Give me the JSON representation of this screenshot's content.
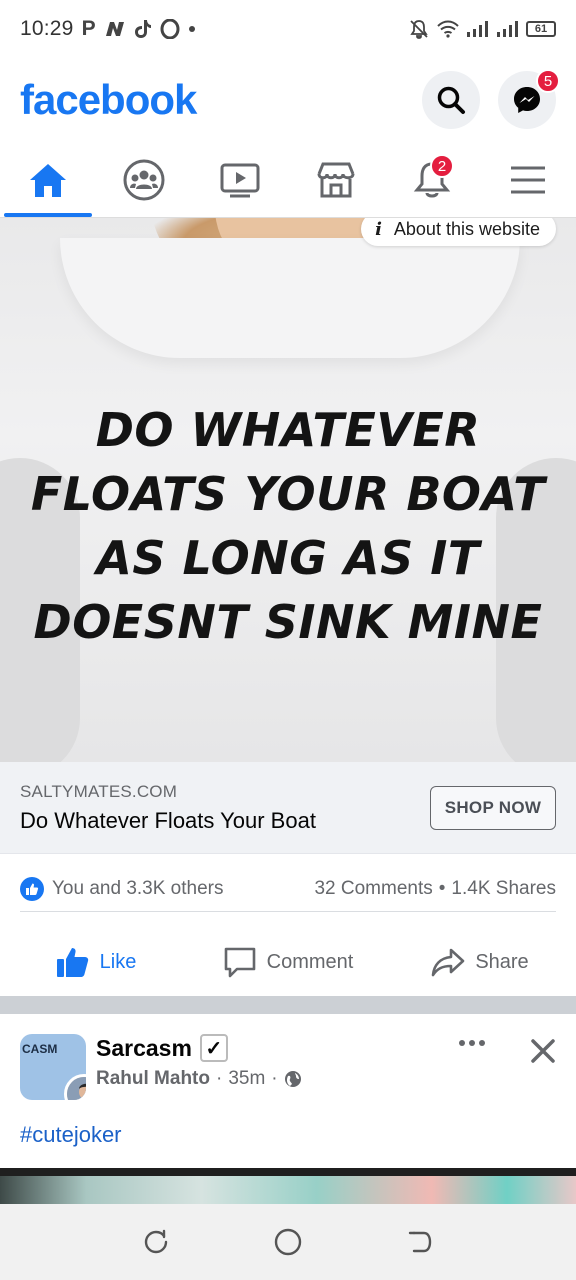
{
  "status_bar": {
    "time": "10:29",
    "app_icons": "P",
    "battery": "61"
  },
  "header": {
    "logo": "facebook",
    "messenger_badge": "5"
  },
  "tabs": {
    "notifications_badge": "2"
  },
  "ad": {
    "about_label": "About this website",
    "slogan_lines": [
      "DO WHATEVER",
      "FLOATS YOUR BOAT",
      "AS LONG AS IT",
      "DOESNT SINK MINE"
    ],
    "domain": "SALTYMATES.COM",
    "title": "Do Whatever Floats Your Boat",
    "cta": "SHOP NOW",
    "reactions": "You and 3.3K others",
    "comments": "32 Comments",
    "dot": "•",
    "shares": "1.4K Shares",
    "actions": {
      "like": "Like",
      "comment": "Comment",
      "share": "Share"
    }
  },
  "post": {
    "page_name": "Sarcasm",
    "verified_mark": "✓",
    "author": "Rahul Mahto",
    "sep": "·",
    "time": "35m",
    "avatar_text": "CASM",
    "hashtag": "#cutejoker"
  },
  "colors": {
    "brand": "#1877f2",
    "badge": "#e41e3f",
    "hashtag": "#1b61c8"
  }
}
